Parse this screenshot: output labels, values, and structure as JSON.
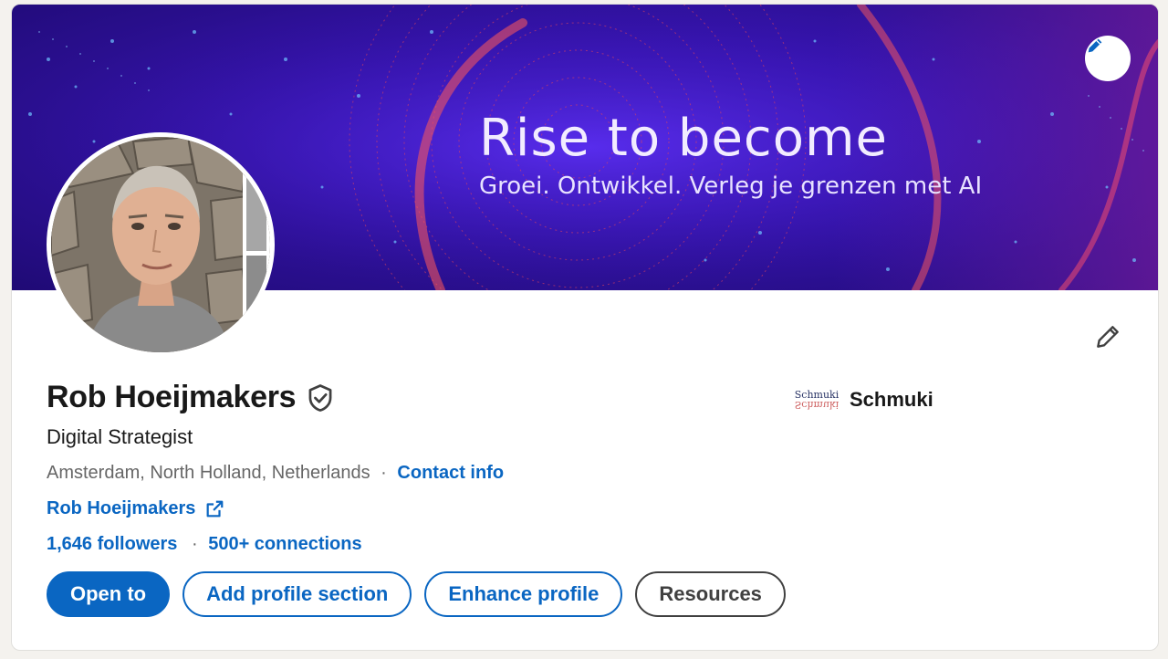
{
  "banner": {
    "headline": "Rise to become",
    "subline": "Groei. Ontwikkel. Verleg je grenzen met AI",
    "edit_icon": "pencil-icon",
    "colors": {
      "base": "#3a15b8",
      "accent": "#e8455a"
    }
  },
  "profile": {
    "name": "Rob Hoeijmakers",
    "verified_icon": "verified-shield-icon",
    "headline": "Digital Strategist",
    "location": "Amsterdam, North Holland, Netherlands",
    "location_separator": "·",
    "contact_label": "Contact info",
    "website_label": "Rob Hoeijmakers",
    "followers": "1,646 followers",
    "stats_separator": "·",
    "connections": "500+ connections"
  },
  "company": {
    "logo_text": "Schmuki",
    "name": "Schmuki"
  },
  "actions": {
    "open_to": "Open to",
    "add_section": "Add profile section",
    "enhance": "Enhance profile",
    "resources": "Resources"
  },
  "colors": {
    "link": "#0a66c2",
    "text": "#191919",
    "muted": "#666666"
  }
}
